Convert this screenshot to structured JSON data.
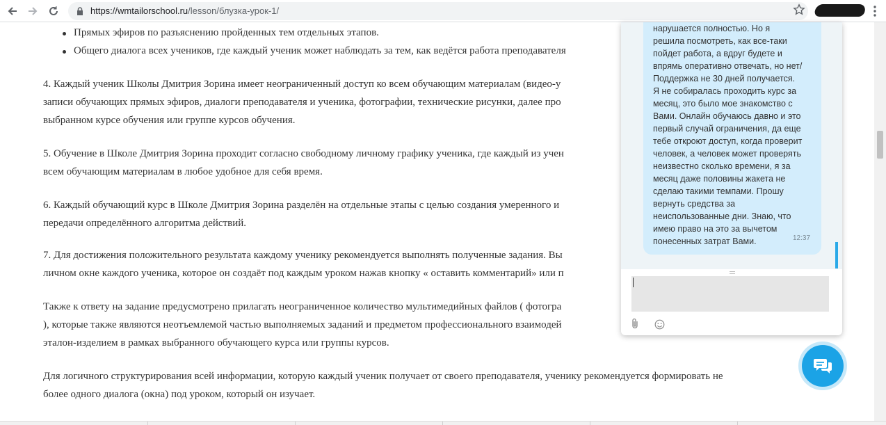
{
  "browser": {
    "url_host": "https://wmtailorschool.ru",
    "url_path": "/lesson/блузка-урок-1/",
    "icons": [
      "back-icon",
      "forward-icon",
      "reload-icon",
      "lock-icon",
      "star-icon",
      "menu-icon"
    ]
  },
  "article": {
    "bullets": [
      "Прямых эфиров по разъяснению пройденных тем отдельных этапов.",
      "Общего диалога всех учеников, где каждый ученик может наблюдать за тем, как ведётся работа преподавателя"
    ],
    "p4": {
      "num": "4.",
      "lines": [
        " Каждый ученик Школы Дмитрия Зорина имеет неограниченный доступ ко всем обучающим материалам (видео-у",
        "записи обучающих прямых эфиров, диалоги преподавателя и ученика, фотографии, технические рисунки, далее про",
        "выбранном курсе обучения или группе курсов обучения."
      ]
    },
    "p5": {
      "num": "5.",
      "lines": [
        " Обучение в Школе Дмитрия Зорина проходит согласно свободному личному графику ученика, где каждый из учен",
        "всем обучающим материалам в любое удобное для себя время."
      ]
    },
    "p6": {
      "num": "6.",
      "lines": [
        " Каждый обучающий курс в Школе Дмитрия Зорина разделён на отдельные этапы с целью создания умеренного и",
        "передачи определённого алгоритма действий."
      ]
    },
    "p7": {
      "num": "7.",
      "lines": [
        " Для достижения положительного результата каждому ученику рекомендуется выполнять полученные задания. Вы",
        "личном окне каждого ученика, которое он создаёт под каждым уроком нажав кнопку « оставить комментарий» или п"
      ]
    },
    "p8": {
      "lines": [
        " Также к ответу на задание предусмотрено прилагать неограниченное количество мультимедийных файлов ( фотогра",
        "), которые также являются неотъемлемой частью выполняемых заданий и предметом профессионального взаимодей",
        "эталон-изделием в рамках выбранного обучающего курса  или группы курсов."
      ]
    },
    "p9": {
      "lines": [
        " Для логичного структурирования всей информации, которую каждый ученик получает от своего преподавателя, ученику рекомендуется формировать не",
        "более одного диалога (окна) под уроком, который он изучает."
      ]
    }
  },
  "chat": {
    "message_lines": [
      "нарушается полностью. Но я",
      "решила посмотреть, как все-таки",
      "пойдет работа, а вдруг будете и",
      "впрямь оперативно отвечать, но нет/",
      "Поддержка не 30 дней получается.",
      "Я не собиралась проходить курс за",
      "месяц, это было мое знакомство с",
      "Вами. Онлайн обучаюсь давно и это",
      "первый случай ограничения, да еще",
      "тебе откроют доступ, когда проверит",
      "человек, а человек может проверять",
      "неизвестно сколько времени, я за",
      "месяц даже половины жакета не",
      "сделаю такими темпами.  Прошу",
      "вернуть средства за",
      "неиспользованные дни. Знаю, что",
      "имею право на это за вычетом",
      "понесенных затрат Вами."
    ],
    "message_time": "12:37",
    "input_value": "",
    "icons": [
      "attach-icon",
      "emoji-icon"
    ],
    "accent_color": "#1ba3e6",
    "bubble_color": "#d3edfc"
  }
}
